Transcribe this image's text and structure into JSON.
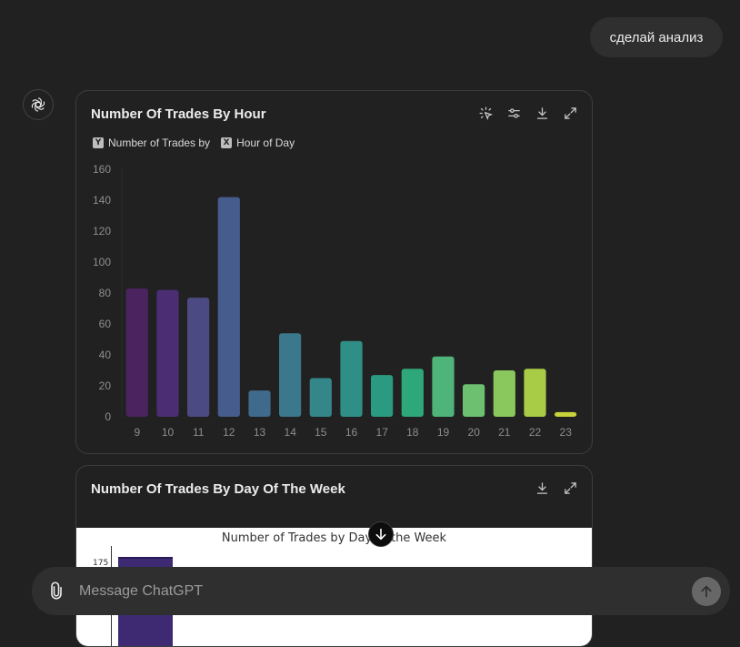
{
  "user_message": {
    "text": "сделай анализ"
  },
  "icons": {
    "assistant_avatar": "openai-logo-icon",
    "toolbar": [
      "interactive-cursor-icon",
      "sliders-icon",
      "download-icon",
      "expand-icon"
    ],
    "attach": "paperclip-icon",
    "send": "arrow-up-icon",
    "scroll": "arrow-down-icon"
  },
  "chart_card": {
    "title": "Number Of Trades By Hour",
    "legend": {
      "y_key": "Y",
      "y_label": "Number of Trades by",
      "x_key": "X",
      "x_label": "Hour of Day"
    }
  },
  "chart_data": {
    "type": "bar",
    "title": "Number Of Trades By Hour",
    "xlabel": "Hour of Day",
    "ylabel": "Number of Trades",
    "categories": [
      "9",
      "10",
      "11",
      "12",
      "13",
      "14",
      "15",
      "16",
      "17",
      "18",
      "19",
      "20",
      "21",
      "22",
      "23"
    ],
    "values": [
      83,
      82,
      77,
      142,
      17,
      54,
      25,
      49,
      27,
      31,
      39,
      21,
      30,
      31,
      3
    ],
    "ylim": [
      0,
      160
    ],
    "yticks": [
      0,
      20,
      40,
      60,
      80,
      100,
      120,
      140,
      160
    ],
    "colors": [
      "#4a235f",
      "#4b2d73",
      "#4c4a82",
      "#465c8c",
      "#3f6a8c",
      "#3b788c",
      "#358689",
      "#2f8f86",
      "#2a9a80",
      "#2ea77a",
      "#4fb47a",
      "#6cc070",
      "#8ac85e",
      "#a9cc47",
      "#c8d43a"
    ],
    "grid": false
  },
  "chart_card_2": {
    "title": "Number Of Trades By Day Of The Week",
    "plot_title": "Number of Trades by Day of the Week",
    "ytick_top": "175"
  },
  "composer": {
    "placeholder": "Message ChatGPT"
  }
}
